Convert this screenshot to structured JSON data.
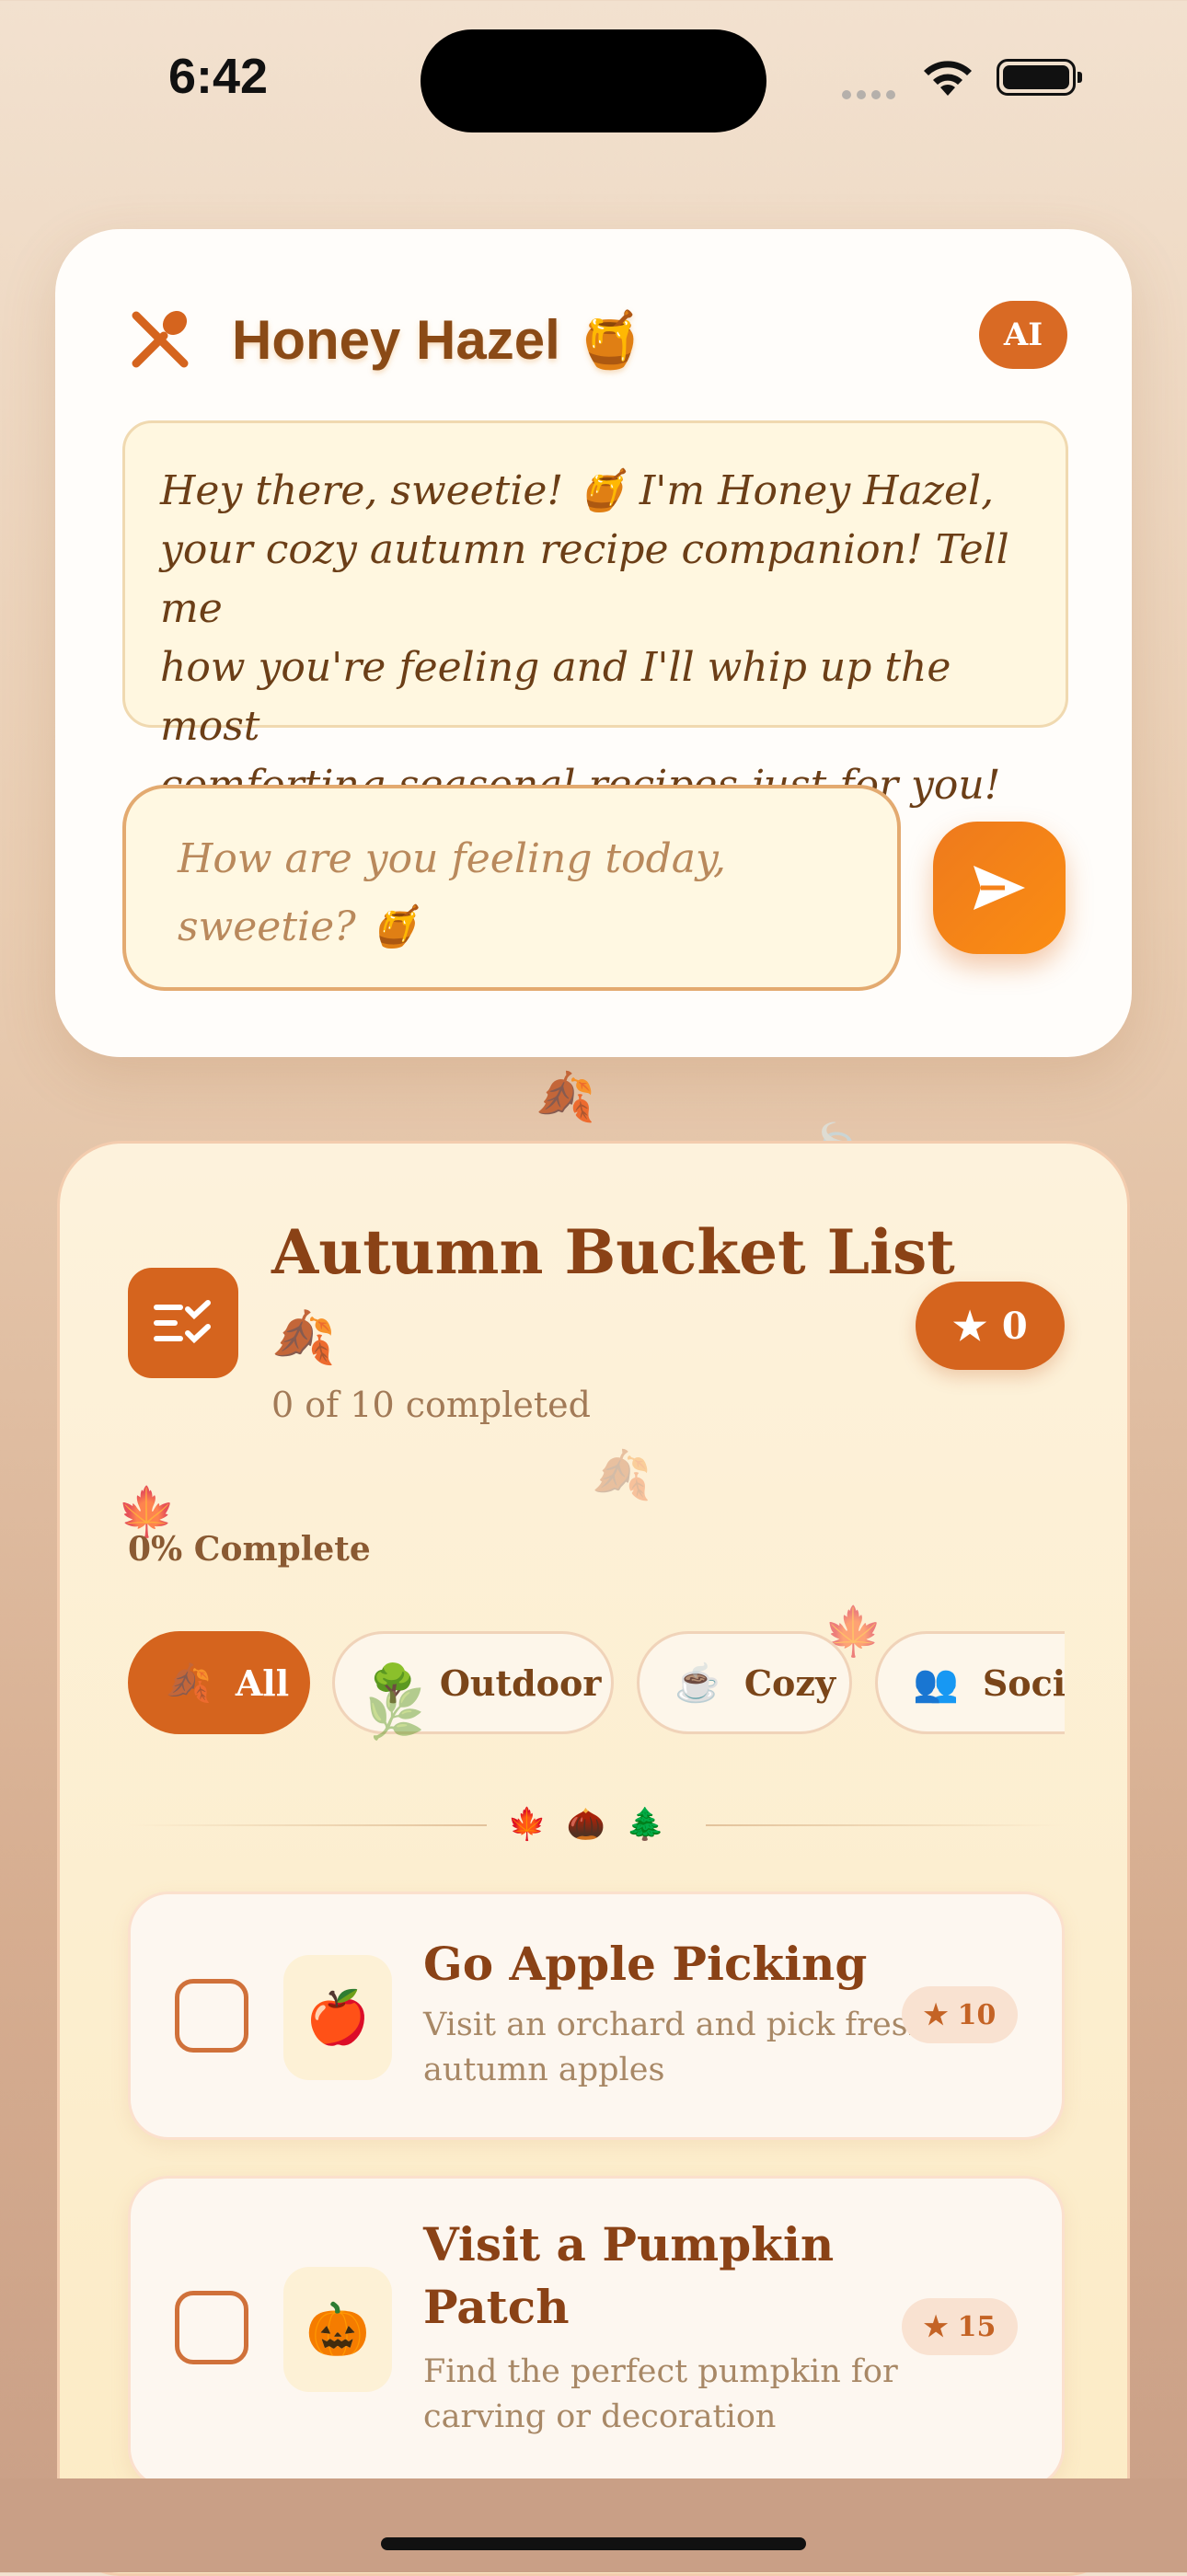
{
  "status_bar": {
    "time": "6:42"
  },
  "chat": {
    "title": "Honey Hazel 🍯",
    "ai_badge": "AI",
    "greeting_lines": [
      "Hey there, sweetie! 🍯 I'm Honey Hazel,",
      "your cozy autumn recipe companion! Tell me",
      "how you're feeling and I'll whip up the most",
      "comforting seasonal recipes just for you! ✨"
    ],
    "input": {
      "placeholder_lines": [
        "How are you feeling today,",
        "sweetie? 🍯"
      ]
    }
  },
  "bucket_list": {
    "title": "Autumn Bucket List",
    "title_emoji": "🍂",
    "completed_text": "0 of 10 completed",
    "points": "0",
    "progress_label": "0% Complete",
    "progress_fraction": 0,
    "filters": [
      {
        "emoji": "🍂",
        "label": "All",
        "active": true
      },
      {
        "emoji": "🌳",
        "label": "Outdoor",
        "active": false
      },
      {
        "emoji": "☕",
        "label": "Cozy",
        "active": false
      },
      {
        "emoji": "👥",
        "label": "Social",
        "active": false
      }
    ],
    "divider_icons": "🍁🌰🌲",
    "items": [
      {
        "emoji": "🍎",
        "title_lines": [
          "Go Apple Picking"
        ],
        "desc_lines": [
          "Visit an orchard and pick fresh",
          "autumn apples"
        ],
        "points": "10"
      },
      {
        "emoji": "🎃",
        "title_lines": [
          "Visit a Pumpkin",
          "Patch"
        ],
        "desc_lines": [
          "Find the perfect pumpkin for",
          "carving or decoration"
        ],
        "points": "15"
      }
    ]
  },
  "colors": {
    "accent": "#d5641e",
    "send_button": "#f5821a",
    "title_brown": "#8a4216",
    "card_bg": "#fdf2dc"
  },
  "icons": {
    "header": "fork-and-spoon-icon",
    "send": "send-icon",
    "list": "checklist-icon",
    "points": "star-icon"
  }
}
